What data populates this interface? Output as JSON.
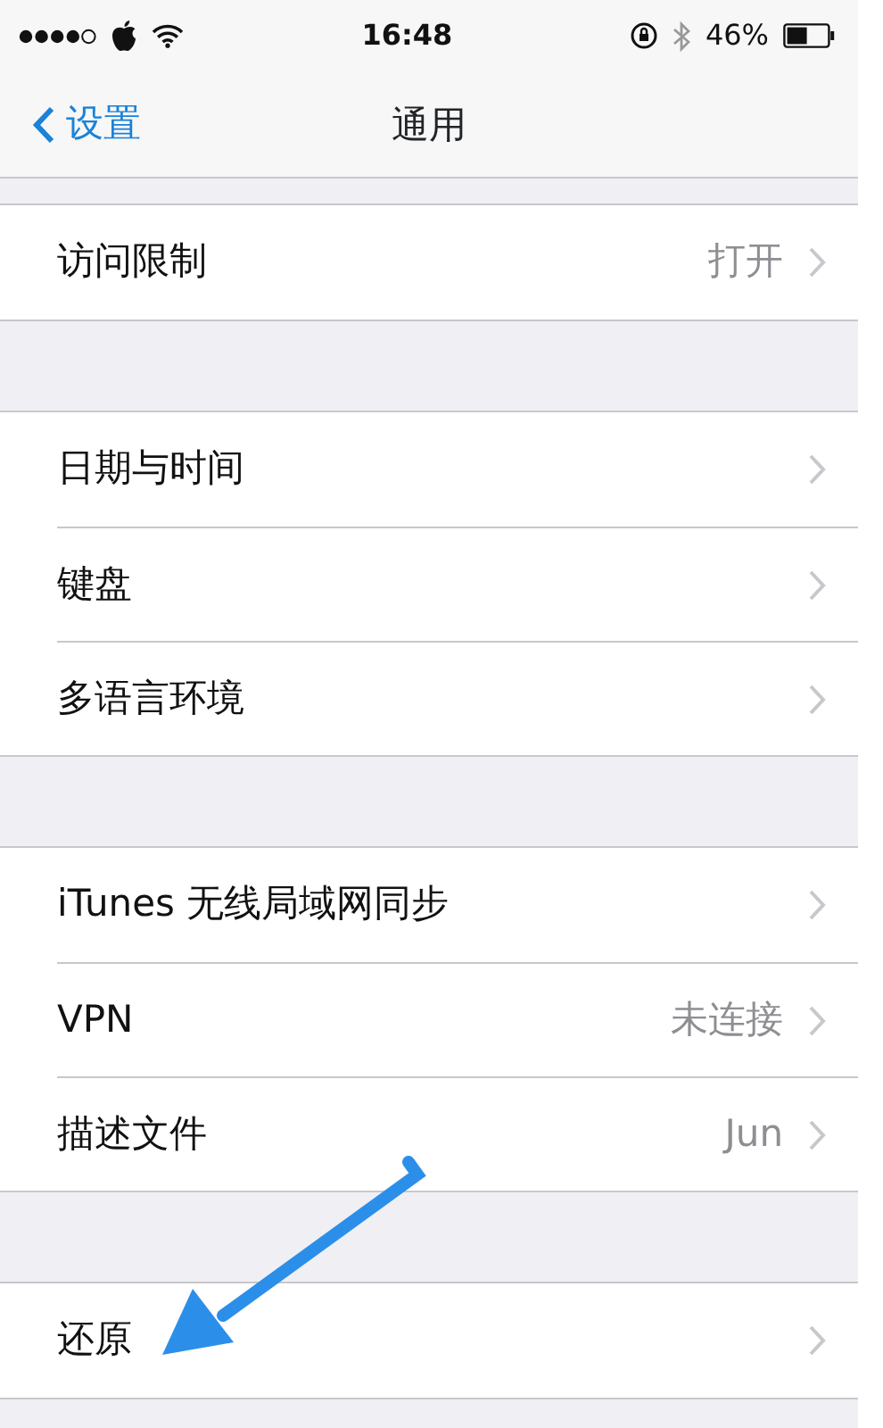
{
  "status_bar": {
    "time": "16:48",
    "battery": "46%"
  },
  "nav": {
    "back": "设置",
    "title": "通用"
  },
  "sections": [
    {
      "rows": [
        {
          "label": "访问限制",
          "value": "打开"
        }
      ]
    },
    {
      "rows": [
        {
          "label": "日期与时间"
        },
        {
          "label": "键盘"
        },
        {
          "label": "多语言环境"
        }
      ]
    },
    {
      "rows": [
        {
          "label": "iTunes 无线局域网同步"
        },
        {
          "label": "VPN",
          "value": "未连接"
        },
        {
          "label": "描述文件",
          "value": "Jun"
        }
      ]
    },
    {
      "rows": [
        {
          "label": "还原"
        }
      ]
    }
  ],
  "annotation_arrow": true
}
